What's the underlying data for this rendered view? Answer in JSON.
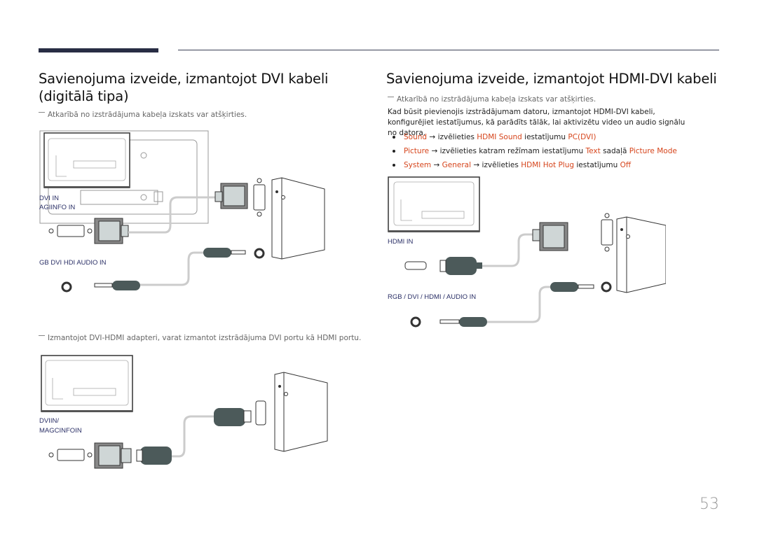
{
  "header": {
    "accent_color": "#282d44"
  },
  "left": {
    "title": "Savienojuma izveide, izmantojot DVI kabeli (digitālā tipa)",
    "note": "Atkarībā no izstrādājuma kabeļa izskats var atšķirties.",
    "diagram1": {
      "label_dvi": "DVI IN",
      "label_magic": "AGIINFO IN",
      "label_audio": "GB  DVI  HDI  AUDIO IN"
    },
    "note2": "Izmantojot DVI-HDMI adapteri, varat izmantot izstrādājuma DVI portu kā HDMI portu.",
    "diagram2": {
      "label_dvi": "DVIIN/",
      "label_magic": "MAGCINFOIN"
    }
  },
  "right": {
    "title": "Savienojuma izveide, izmantojot HDMI-DVI kabeli",
    "note": "Atkarībā no izstrādājuma kabeļa izskats var atšķirties.",
    "body": "Kad būsit pievienojis izstrādājumam datoru, izmantojot HDMI-DVI kabeli, konfigurējiet iestatījumus, kā parādīts tālāk, lai aktivizētu video un audio signālu no datora.",
    "bullets": [
      {
        "parts": [
          {
            "t": "Sound",
            "hl": true
          },
          {
            "t": " → ",
            "hl": false
          },
          {
            "t": " izvēlieties ",
            "hl": false
          },
          {
            "t": "HDMI Sound",
            "hl": true
          },
          {
            "t": " iestatījumu ",
            "hl": false
          },
          {
            "t": "PC(DVI)",
            "hl": true
          }
        ]
      },
      {
        "parts": [
          {
            "t": "Picture",
            "hl": true
          },
          {
            "t": " → izvēlieties katram režīmam iestatījumu ",
            "hl": false
          },
          {
            "t": "Text",
            "hl": true
          },
          {
            "t": " sadaļā ",
            "hl": false
          },
          {
            "t": "Picture Mode",
            "hl": true
          }
        ]
      },
      {
        "parts": [
          {
            "t": "System",
            "hl": true
          },
          {
            "t": " → ",
            "hl": false
          },
          {
            "t": "General",
            "hl": true
          },
          {
            "t": " → izvēlieties ",
            "hl": false
          },
          {
            "t": "HDMI Hot Plug",
            "hl": true
          },
          {
            "t": " iestatījumu ",
            "hl": false
          },
          {
            "t": "Off",
            "hl": true
          }
        ]
      }
    ],
    "highlight_color": "#d6451c",
    "diagram": {
      "label_hdmi": "HDMI IN",
      "label_audio": "RGB / DVI / HDMI / AUDIO IN"
    }
  },
  "footer": {
    "page_number": "53"
  }
}
